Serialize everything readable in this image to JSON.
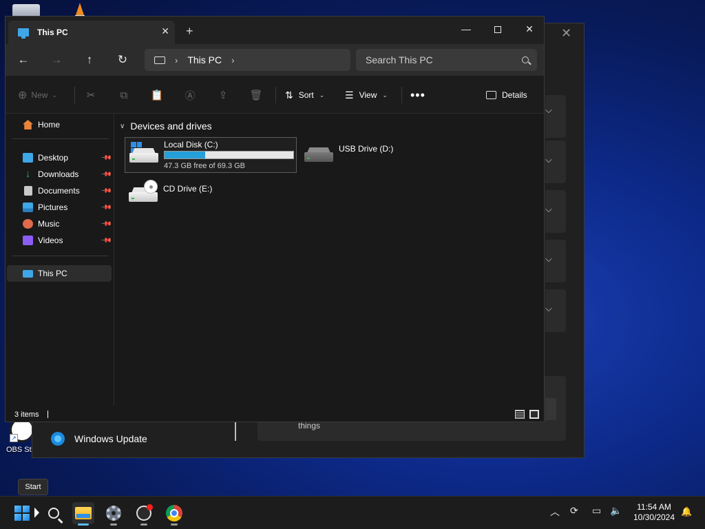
{
  "desktop": {
    "obs_label": "OBS Stu"
  },
  "background_window": {
    "list_item_label": "Windows Update",
    "card_text": "things",
    "close_glyph": "✕",
    "chevron_glyph": "⌵"
  },
  "explorer": {
    "tab_title": "This PC",
    "tab_close": "✕",
    "new_tab": "+",
    "window_controls": {
      "minimize": "—",
      "close": "✕"
    },
    "nav": {
      "back": "←",
      "forward": "→",
      "up": "↑",
      "refresh": "↻"
    },
    "address": {
      "chevron": "›",
      "location": "This PC",
      "trailing_chevron": "›"
    },
    "search": {
      "placeholder": "Search This PC"
    },
    "commands": {
      "new_label": "New",
      "cut_icon": "✂",
      "copy_icon": "⧉",
      "paste_icon": "📋",
      "rename_icon": "Ⓐ",
      "share_icon": "⇪",
      "delete_icon": "🗑",
      "sort_label": "Sort",
      "view_label": "View",
      "more_label": "•••",
      "details_label": "Details"
    },
    "sidebar": {
      "home": {
        "label": "Home",
        "color": "#e8853a"
      },
      "pinned": [
        {
          "label": "Desktop",
          "color": "#3fa7e8"
        },
        {
          "label": "Downloads",
          "color": "#37b34a"
        },
        {
          "label": "Documents",
          "color": "#c9c9c9"
        },
        {
          "label": "Pictures",
          "color": "#3fa7e8"
        },
        {
          "label": "Music",
          "color": "#e06a4a"
        },
        {
          "label": "Videos",
          "color": "#8b5cf6"
        }
      ],
      "this_pc": {
        "label": "This PC",
        "color": "#3fa7e8"
      }
    },
    "content": {
      "section_title": "Devices and drives",
      "drives": [
        {
          "name": "Local Disk (C:)",
          "free_text": "47.3 GB free of 69.3 GB",
          "used_fraction": 0.317
        },
        {
          "name": "USB Drive (D:)"
        },
        {
          "name": "CD Drive (E:)"
        }
      ]
    },
    "status": {
      "item_count": "3 items"
    }
  },
  "tooltip": {
    "text": "Start"
  },
  "taskbar": {
    "clock_time": "11:54 AM",
    "clock_date": "10/30/2024",
    "tray_up": "︿",
    "tray_sync": "⟳",
    "tray_net": "▭",
    "tray_vol": "🔈",
    "bell": "🔔"
  }
}
